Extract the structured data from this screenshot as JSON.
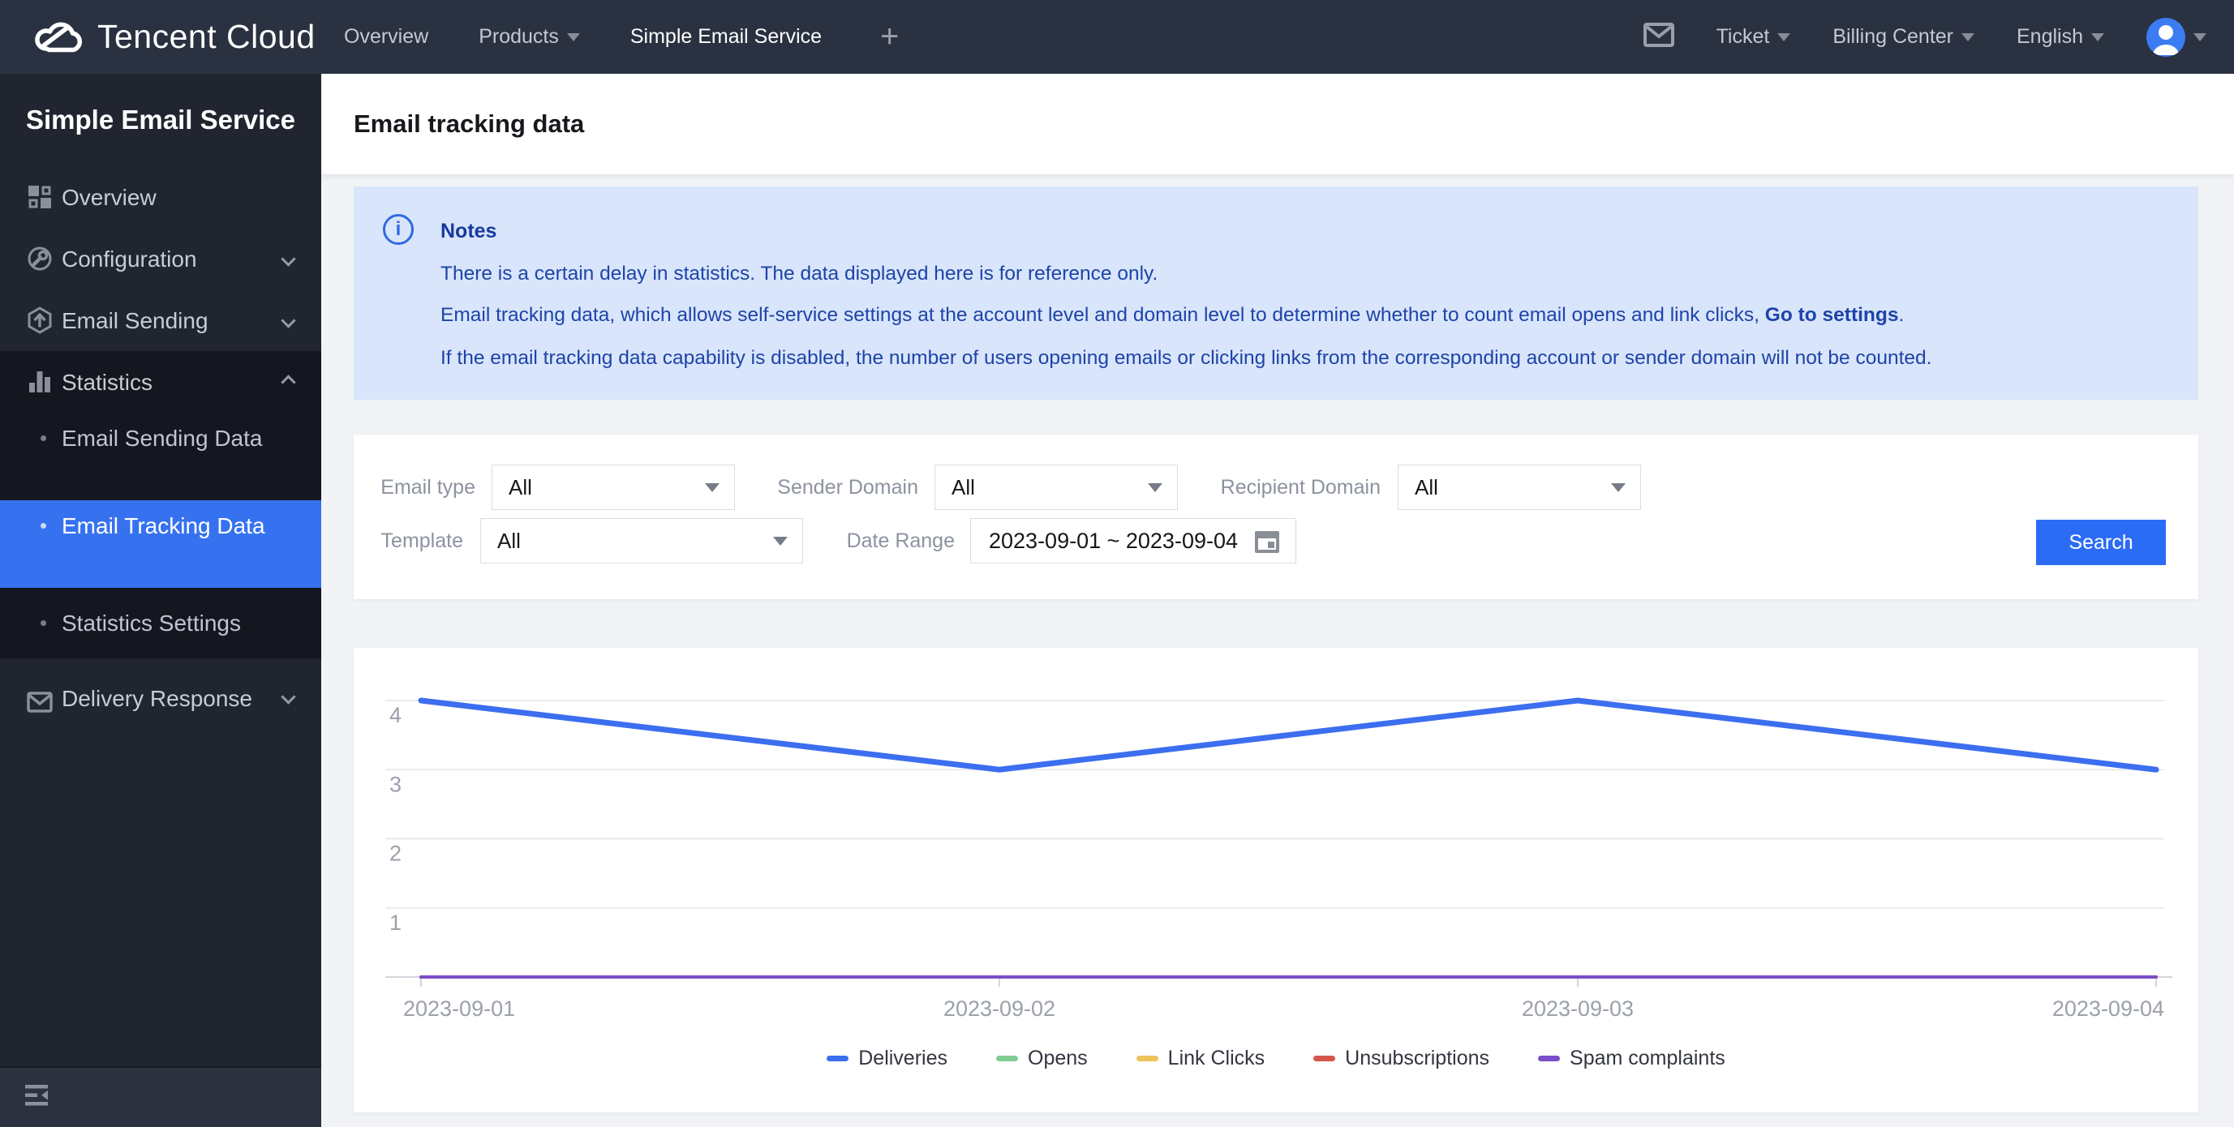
{
  "navbar": {
    "brand": "Tencent Cloud",
    "left": [
      {
        "label": "Overview",
        "caret": false
      },
      {
        "label": "Products",
        "caret": true
      },
      {
        "label": "Simple Email Service",
        "caret": false
      },
      {
        "label": "+",
        "caret": false
      }
    ],
    "right": [
      {
        "label": "Ticket",
        "caret": true
      },
      {
        "label": "Billing Center",
        "caret": true
      },
      {
        "label": "English",
        "caret": true
      }
    ]
  },
  "sidebar": {
    "title": "Simple Email Service",
    "items": [
      {
        "label": "Overview",
        "icon": "grid-icon",
        "chevron": "none"
      },
      {
        "label": "Configuration",
        "icon": "config-icon",
        "chevron": "down"
      },
      {
        "label": "Email Sending",
        "icon": "send-icon",
        "chevron": "down"
      },
      {
        "label": "Statistics",
        "icon": "stats-icon",
        "chevron": "up",
        "children": [
          {
            "label": "Email Sending Data",
            "selected": false
          },
          {
            "label": "Email Tracking Data",
            "selected": true
          },
          {
            "label": "Statistics Settings",
            "selected": false
          }
        ]
      },
      {
        "label": "Delivery Response",
        "icon": "mail-icon",
        "chevron": "down"
      }
    ]
  },
  "header": {
    "title": "Email tracking data"
  },
  "notes": {
    "title": "Notes",
    "line1": "There is a certain delay in statistics. The data displayed here is for reference only.",
    "line2_prefix": "Email tracking data, which allows self-service settings at the account level and domain level to determine whether to count email opens and link clicks, ",
    "line2_link": "Go to settings",
    "line2_suffix": ".",
    "line3": "If the email tracking data capability is disabled, the number of users opening emails or clicking links from the corresponding account or sender domain will not be counted."
  },
  "filters": {
    "email_type": {
      "label": "Email type",
      "value": "All"
    },
    "sender_domain": {
      "label": "Sender Domain",
      "value": "All"
    },
    "recipient_domain": {
      "label": "Recipient Domain",
      "value": "All"
    },
    "template": {
      "label": "Template",
      "value": "All"
    },
    "date_range": {
      "label": "Date Range",
      "value": "2023-09-01  ~ 2023-09-04"
    },
    "search_label": "Search"
  },
  "chart_data": {
    "type": "line",
    "title": "",
    "x": [
      "2023-09-01",
      "2023-09-02",
      "2023-09-03",
      "2023-09-04"
    ],
    "series": [
      {
        "name": "Deliveries",
        "values": [
          4,
          3,
          4,
          3
        ],
        "color": "#3c6ef0",
        "width": 7
      },
      {
        "name": "Opens",
        "values": [
          0,
          0,
          0,
          0
        ],
        "color": "#82cd94",
        "width": 4
      },
      {
        "name": "Link Clicks",
        "values": [
          0,
          0,
          0,
          0
        ],
        "color": "#edc45c",
        "width": 4
      },
      {
        "name": "Unsubscriptions",
        "values": [
          0,
          0,
          0,
          0
        ],
        "color": "#d4574e",
        "width": 4
      },
      {
        "name": "Spam complaints",
        "values": [
          0,
          0,
          0,
          0
        ],
        "color": "#7a4ec8",
        "width": 4
      }
    ],
    "y_ticks": [
      1,
      2,
      3,
      4
    ],
    "ylim": [
      0,
      4.5
    ],
    "grid": true,
    "legend_position": "bottom"
  },
  "colors": {
    "accent_blue": "#2b6cf5",
    "selected_nav_blue": "#3672f0",
    "notes_bg": "#d9e5fb",
    "notes_text": "#1d44a8",
    "topbar_bg": "#2a3140",
    "sidebar_bg": "#20252f"
  }
}
